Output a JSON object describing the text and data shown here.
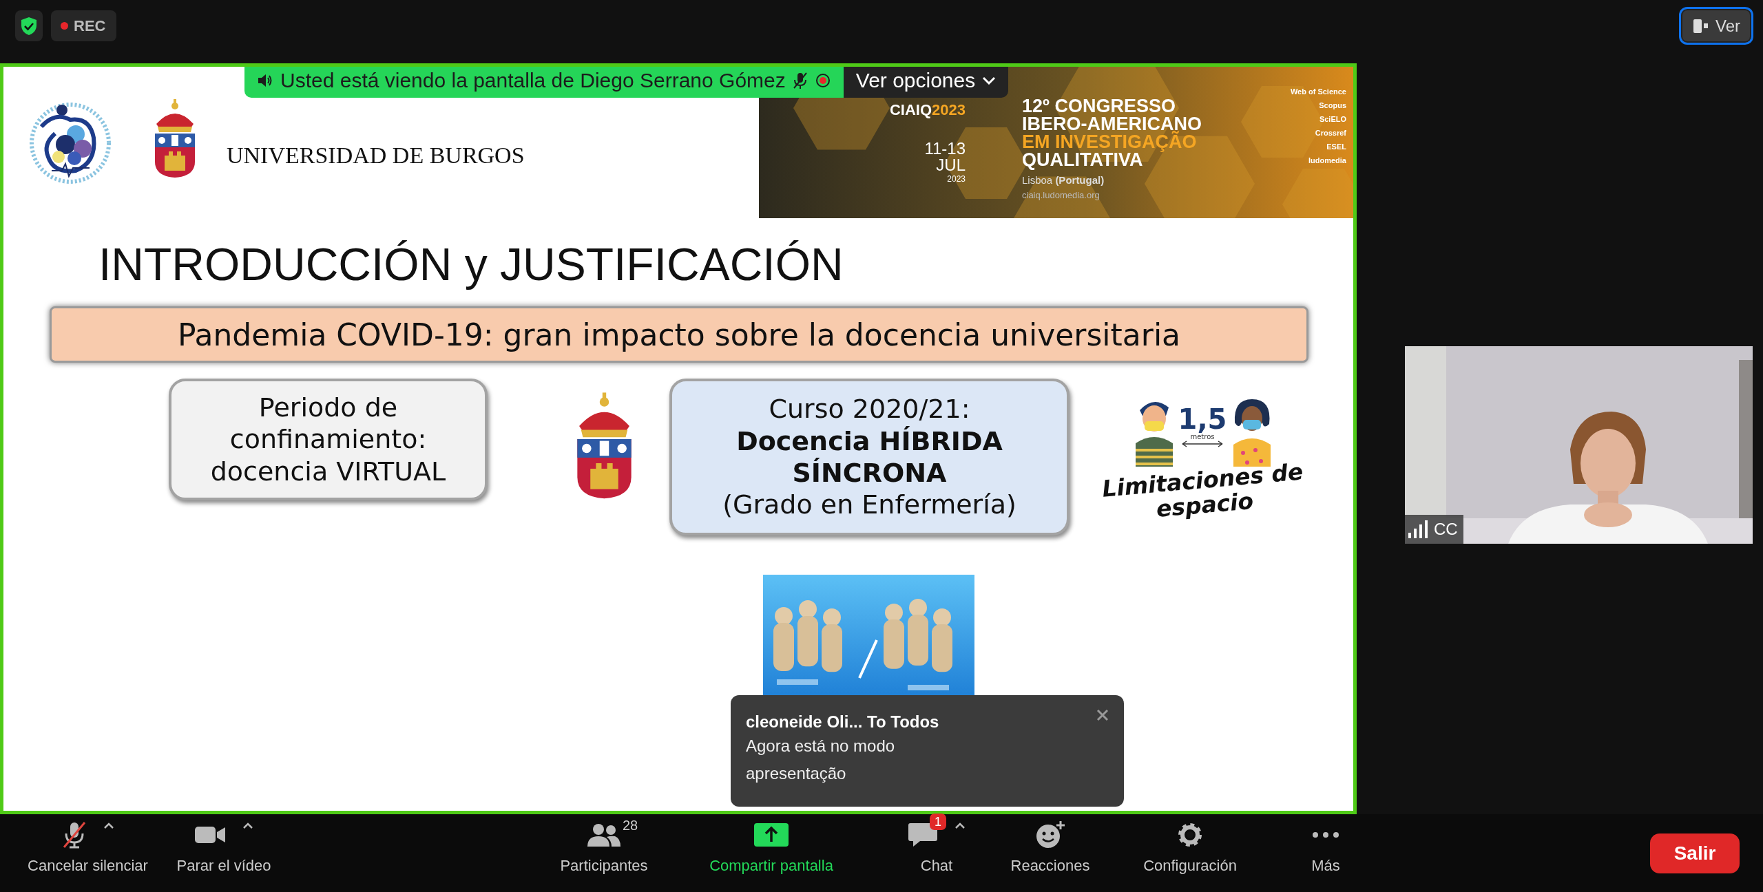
{
  "top_bar": {
    "recording_label": "REC",
    "view_button": "Ver"
  },
  "share_banner": {
    "text": "Usted está viendo la pantalla de Diego Serrano Gómez",
    "options_label": "Ver opciones"
  },
  "slide": {
    "institution": "UNIVERSIDAD DE BURGOS",
    "conference": {
      "brand": "CIAIQ",
      "brand_year": "2023",
      "dates": [
        "11-13",
        "JUL",
        "2023"
      ],
      "lines": [
        {
          "text": "12º CONGRESSO",
          "accent": false
        },
        {
          "text": "IBERO-AMERICANO",
          "accent": false
        },
        {
          "text": "EM INVESTIGAÇÃO",
          "accent": true
        },
        {
          "text": "QUALITATIVA",
          "accent": false
        }
      ],
      "place": "Lisboa **(Portugal)**",
      "url": "ciaiq.ludomedia.org",
      "indexes": [
        "Web of Science",
        "Scopus",
        "SciELO",
        "Crossref",
        "ESEL",
        "ludomedia"
      ]
    },
    "title": "INTRODUCCIÓN y JUSTIFICACIÓN",
    "headline": "Pandemia COVID-19: gran impacto sobre la docencia universitaria",
    "boxes": [
      {
        "color": "#f2f2f2",
        "lines": [
          {
            "text": "Periodo de",
            "bold": false
          },
          {
            "text": "confinamiento:",
            "bold": false
          },
          {
            "text": "docencia VIRTUAL",
            "bold": false
          }
        ]
      },
      {
        "color": "#dce7f6",
        "lines": [
          {
            "text": "Curso 2020/21:",
            "bold": false
          },
          {
            "text": "Docencia HÍBRIDA",
            "bold": true
          },
          {
            "text": "SÍNCRONA",
            "bold": true
          },
          {
            "text": "(Grado en Enfermería)",
            "bold": false
          }
        ]
      }
    ],
    "distance": {
      "value": "1,5",
      "unit": "metros"
    },
    "caption": "Limitaciones de espacio"
  },
  "toast": {
    "title": "cleoneide Oli... To Todos",
    "message": "Agora está no modo apresentação"
  },
  "video_tile": {
    "label": "CC"
  },
  "toolbar": {
    "items": [
      {
        "kind": "mic",
        "label": "Cancelar silenciar",
        "muted": true,
        "caret": true
      },
      {
        "kind": "video",
        "label": "Parar el vídeo",
        "muted": false,
        "caret": true
      },
      {
        "kind": "participants",
        "label": "Participantes",
        "count": "28",
        "caret": false
      },
      {
        "kind": "share",
        "label": "Compartir pantalla",
        "caret": false
      },
      {
        "kind": "chat",
        "label": "Chat",
        "badge": "1",
        "caret": true
      },
      {
        "kind": "reactions",
        "label": "Reacciones",
        "caret": false
      },
      {
        "kind": "settings",
        "label": "Configuración",
        "caret": false
      },
      {
        "kind": "more",
        "label": "Más",
        "caret": false
      }
    ],
    "leave_button": "Salir"
  }
}
